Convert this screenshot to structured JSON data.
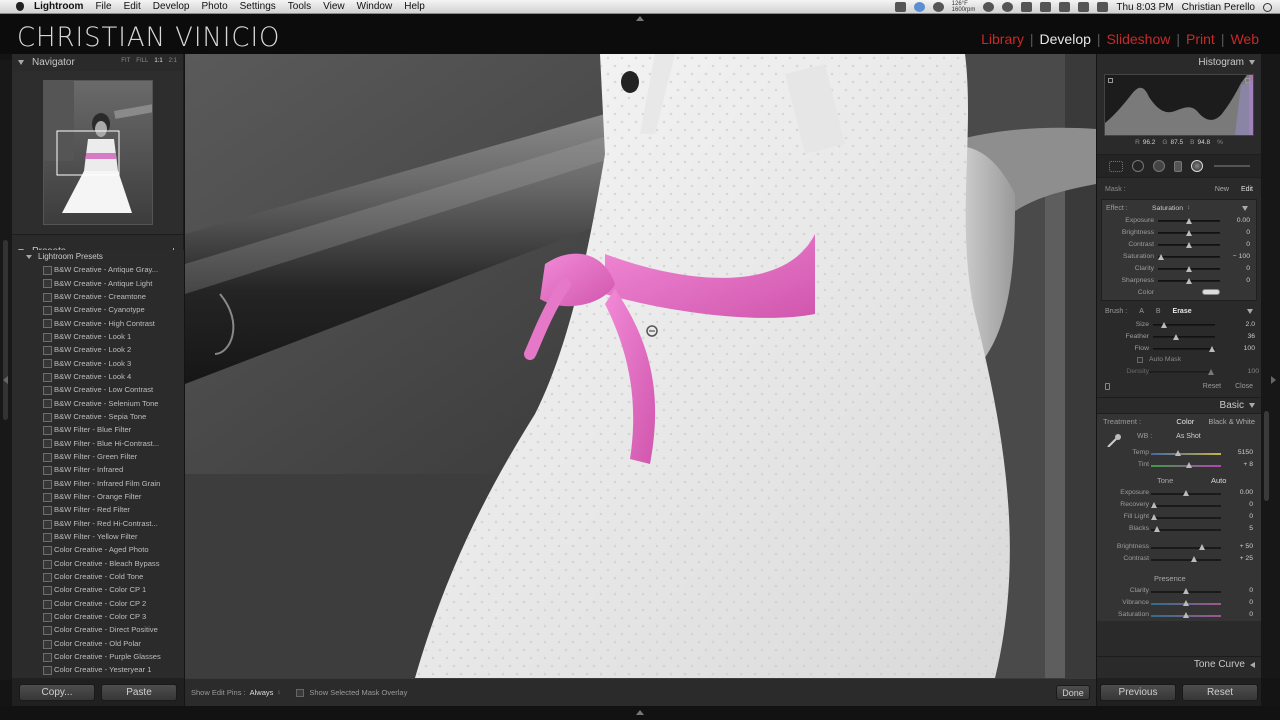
{
  "menubar": {
    "app": "Lightroom",
    "items": [
      "File",
      "Edit",
      "Develop",
      "Photo",
      "Settings",
      "Tools",
      "View",
      "Window",
      "Help"
    ],
    "tray_temp": "126°F",
    "tray_rpm": "1600rpm",
    "clock": "Thu 8:03 PM",
    "user": "Christian Perello"
  },
  "identity": {
    "logo": "CHRISTIAN VINICIO",
    "modules": [
      "Library",
      "Develop",
      "Slideshow",
      "Print",
      "Web"
    ],
    "active_module": "Develop",
    "accent": "#c72a2a"
  },
  "navigator": {
    "title": "Navigator",
    "zoom_options": [
      "FIT",
      "FILL",
      "1:1",
      "2:1"
    ]
  },
  "presets": {
    "title": "Presets",
    "add": "+",
    "folder": "Lightroom Presets",
    "items": [
      "B&W Creative - Antique Gray...",
      "B&W Creative - Antique Light",
      "B&W Creative - Creamtone",
      "B&W Creative - Cyanotype",
      "B&W Creative - High Contrast",
      "B&W Creative - Look 1",
      "B&W Creative - Look 2",
      "B&W Creative - Look 3",
      "B&W Creative - Look 4",
      "B&W Creative - Low Contrast",
      "B&W Creative - Selenium Tone",
      "B&W Creative - Sepia Tone",
      "B&W Filter - Blue Filter",
      "B&W Filter - Blue Hi-Contrast...",
      "B&W Filter - Green Filter",
      "B&W Filter - Infrared",
      "B&W Filter - Infrared Film Grain",
      "B&W Filter - Orange Filter",
      "B&W Filter - Red Filter",
      "B&W Filter - Red Hi-Contrast...",
      "B&W Filter - Yellow Filter",
      "Color Creative - Aged Photo",
      "Color Creative - Bleach Bypass",
      "Color Creative - Cold Tone",
      "Color Creative - Color CP 1",
      "Color Creative - Color CP 2",
      "Color Creative - Color CP 3",
      "Color Creative - Direct Positive",
      "Color Creative - Old Polar",
      "Color Creative - Purple Glasses",
      "Color Creative - Yesteryear 1"
    ]
  },
  "left_footer": {
    "copy": "Copy...",
    "paste": "Paste"
  },
  "toolbar": {
    "show_pins_label": "Show Edit Pins :",
    "show_pins_value": "Always",
    "overlay_label": "Show Selected Mask Overlay",
    "done": "Done"
  },
  "histogram": {
    "title": "Histogram",
    "r_label": "R",
    "r_value": "96.2",
    "g_label": "G",
    "g_value": "87.5",
    "b_label": "B",
    "b_value": "94.8",
    "unit": "%"
  },
  "mask": {
    "label": "Mask :",
    "new": "New",
    "edit": "Edit",
    "effect_label": "Effect :",
    "effect_value": "Saturation",
    "sliders": [
      {
        "label": "Exposure",
        "value": "0.00",
        "pos": 0.5
      },
      {
        "label": "Brightness",
        "value": "0",
        "pos": 0.5
      },
      {
        "label": "Contrast",
        "value": "0",
        "pos": 0.5
      },
      {
        "label": "Saturation",
        "value": "− 100",
        "pos": 0.0
      },
      {
        "label": "Clarity",
        "value": "0",
        "pos": 0.5
      },
      {
        "label": "Sharpness",
        "value": "0",
        "pos": 0.5
      }
    ],
    "color_label": "Color"
  },
  "brush": {
    "label": "Brush :",
    "a": "A",
    "b": "B",
    "erase": "Erase",
    "sliders": [
      {
        "label": "Size",
        "value": "2.0",
        "pos": 0.15
      },
      {
        "label": "Feather",
        "value": "36",
        "pos": 0.36
      },
      {
        "label": "Flow",
        "value": "100",
        "pos": 1.0
      }
    ],
    "auto_mask": "Auto Mask",
    "density_label": "Density",
    "density_value": "100",
    "reset": "Reset",
    "close": "Close"
  },
  "basic": {
    "title": "Basic",
    "treatment_label": "Treatment :",
    "color": "Color",
    "bw": "Black & White",
    "wb_label": "WB :",
    "wb_value": "As Shot",
    "temp_label": "Temp",
    "temp_value": "5150",
    "temp_pos": 0.38,
    "tint_label": "Tint",
    "tint_value": "+ 8",
    "tint_pos": 0.54,
    "tone_label": "Tone",
    "auto": "Auto",
    "tone_sliders": [
      {
        "label": "Exposure",
        "value": "0.00",
        "pos": 0.5
      },
      {
        "label": "Recovery",
        "value": "0",
        "pos": 0.0
      },
      {
        "label": "Fill Light",
        "value": "0",
        "pos": 0.0
      },
      {
        "label": "Blacks",
        "value": "5",
        "pos": 0.05
      }
    ],
    "bc_sliders": [
      {
        "label": "Brightness",
        "value": "+ 50",
        "pos": 0.75
      },
      {
        "label": "Contrast",
        "value": "+ 25",
        "pos": 0.62
      }
    ],
    "presence_label": "Presence",
    "presence_sliders": [
      {
        "label": "Clarity",
        "value": "0",
        "pos": 0.5
      },
      {
        "label": "Vibrance",
        "value": "0",
        "pos": 0.5
      },
      {
        "label": "Saturation",
        "value": "0",
        "pos": 0.5
      }
    ]
  },
  "tone_curve": {
    "title": "Tone Curve"
  },
  "right_footer": {
    "previous": "Previous",
    "reset": "Reset"
  }
}
